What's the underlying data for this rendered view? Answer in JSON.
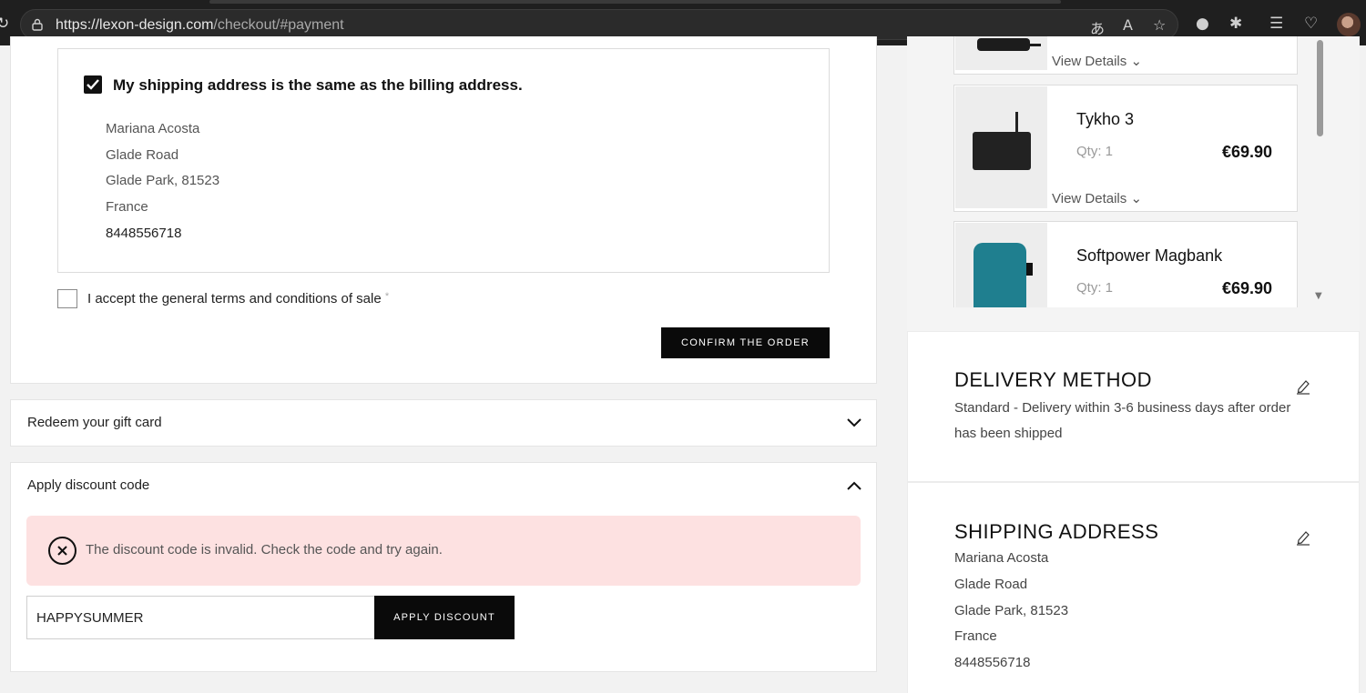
{
  "browser": {
    "url_host": "https://lexon-design.com",
    "url_path": "/checkout/#payment"
  },
  "billing": {
    "same_address_label": "My shipping address is the same as the billing address.",
    "same_address_checked": true,
    "address_lines": [
      "Mariana Acosta",
      "Glade Road",
      "Glade Park, 81523",
      "France"
    ],
    "phone": "8448556718",
    "terms_label": "I accept the general terms and conditions of sale",
    "terms_required_mark": "*",
    "terms_checked": false,
    "confirm_label": "CONFIRM THE ORDER"
  },
  "gift_card": {
    "title": "Redeem your gift card"
  },
  "discount": {
    "title": "Apply discount code",
    "error_message": "The discount code is invalid. Check the code and try again.",
    "code_value": "HAPPYSUMMER",
    "apply_label": "APPLY DISCOUNT"
  },
  "cart": {
    "items": [
      {
        "name": "",
        "qty": "",
        "price": "",
        "view_details": "View Details"
      },
      {
        "name": "Tykho 3",
        "qty": "Qty: 1",
        "price": "€69.90",
        "view_details": "View Details"
      },
      {
        "name": "Softpower Magbank",
        "qty": "Qty: 1",
        "price": "€69.90",
        "view_details": ""
      }
    ]
  },
  "delivery": {
    "title": "DELIVERY METHOD",
    "text": "Standard - Delivery within 3-6 business days after order has been shipped"
  },
  "shipping": {
    "title": "SHIPPING ADDRESS",
    "lines": [
      "Mariana Acosta",
      "Glade Road",
      "Glade Park, 81523",
      "France",
      "8448556718"
    ]
  },
  "colors": {
    "accent": "#0a0a0a",
    "error_bg": "#fde1e1",
    "teal_product": "#1f7f8f"
  }
}
